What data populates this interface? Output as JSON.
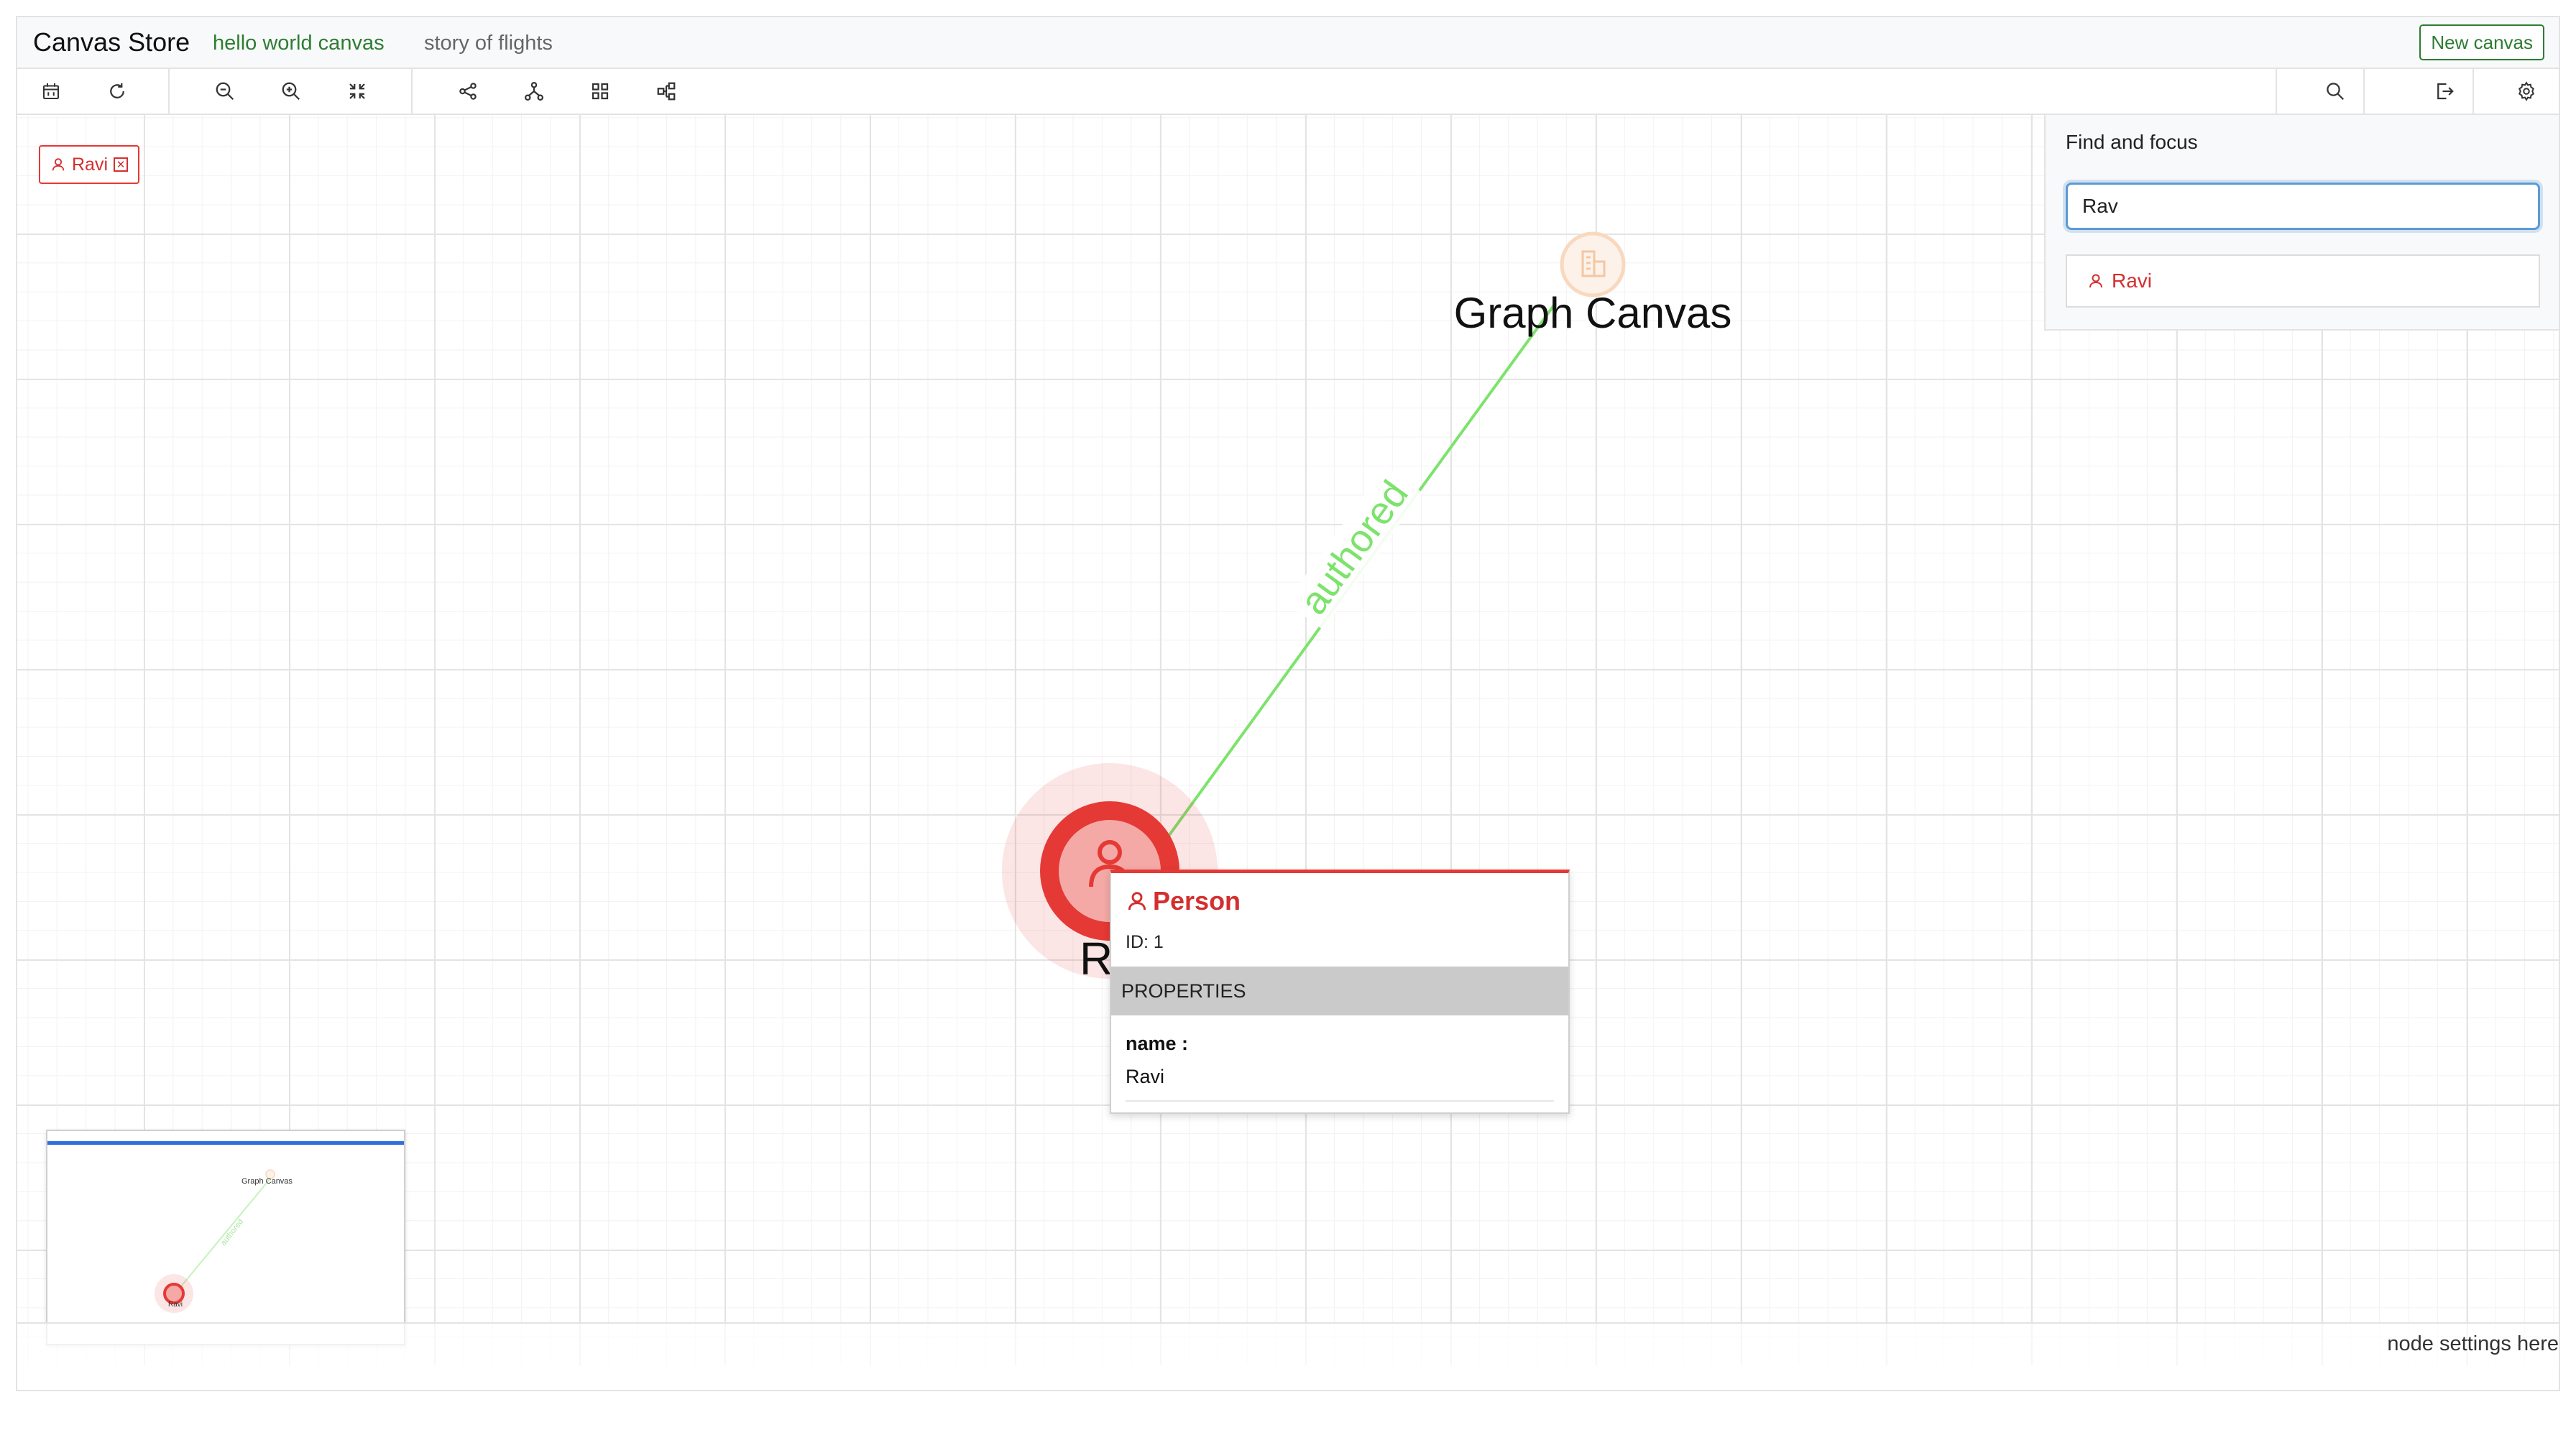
{
  "header": {
    "app_title": "Canvas Store",
    "tabs": [
      {
        "label": "hello world canvas",
        "active": true
      },
      {
        "label": "story of flights",
        "active": false
      }
    ],
    "new_canvas_label": "New canvas"
  },
  "toolbar": {
    "icons": [
      "calendar-icon",
      "refresh-icon",
      "zoom-out-icon",
      "zoom-in-icon",
      "fit-screen-icon",
      "share-graph-icon",
      "hierarchy-icon",
      "grid-layout-icon",
      "flow-layout-icon",
      "search-icon",
      "export-icon",
      "settings-icon"
    ]
  },
  "selection": {
    "chip_label": "Ravi",
    "chip_close_glyph": "✕"
  },
  "find": {
    "title": "Find and focus",
    "query": "Rav",
    "results": [
      {
        "label": "Ravi",
        "icon": "person-icon"
      }
    ]
  },
  "graph": {
    "nodes": [
      {
        "label": "Ravi",
        "type": "Person",
        "color": "#e53935",
        "icon": "person-icon",
        "selected": true
      },
      {
        "label": "Graph Canvas",
        "type": "Project",
        "color": "#f4b383",
        "icon": "building-icon",
        "selected": false
      }
    ],
    "edges": [
      {
        "label": "authored",
        "color": "#7ce36b"
      }
    ]
  },
  "popup": {
    "type_label": "Person",
    "id_label": "ID: 1",
    "properties_header": "PROPERTIES",
    "property_key": "name :",
    "property_value": "Ravi"
  },
  "minimap": {
    "graph_label": "Graph Canvas",
    "edge_label": "authored",
    "node_label": "Ravi"
  },
  "footer": {
    "status_text": "node settings here"
  },
  "colors": {
    "accent_green": "#2e7d32",
    "person_red": "#e53935",
    "edge_green": "#7ce36b",
    "focus_blue": "#5b9bd5",
    "minimap_bar": "#2f6fde"
  }
}
